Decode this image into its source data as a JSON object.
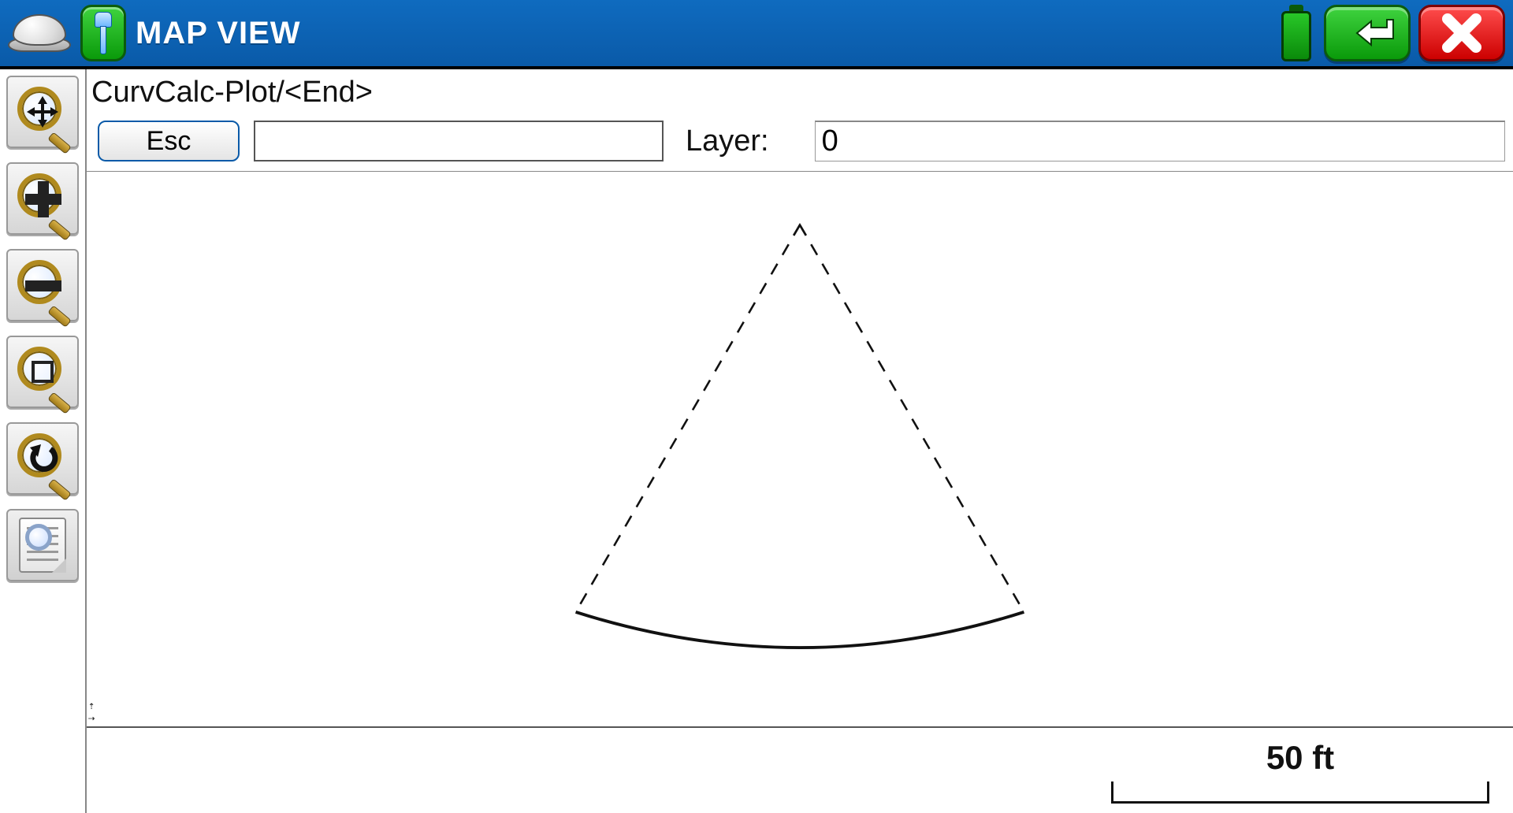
{
  "header": {
    "title": "MAP VIEW",
    "icons": {
      "home": "hardhat-icon",
      "instrument": "probe-icon",
      "battery": "battery-icon",
      "back": "back-arrow-icon",
      "close": "close-x-icon"
    }
  },
  "sidebar": {
    "tools": [
      {
        "name": "zoom-extents",
        "icon": "pan-arrows-icon"
      },
      {
        "name": "zoom-in",
        "icon": "plus-icon"
      },
      {
        "name": "zoom-out",
        "icon": "minus-icon"
      },
      {
        "name": "zoom-window",
        "icon": "window-icon"
      },
      {
        "name": "zoom-previous",
        "icon": "undo-icon"
      },
      {
        "name": "page-view",
        "icon": "page-icon"
      }
    ]
  },
  "main": {
    "breadcrumb": "CurvCalc-Plot/<End>",
    "esc_label": "Esc",
    "command_value": "",
    "layer_label": "Layer:",
    "layer_value": "0"
  },
  "scale": {
    "label": "50 ft"
  },
  "colors": {
    "titlebar": "#0a5aa8",
    "green": "#1ea81e",
    "red": "#cc0000"
  }
}
